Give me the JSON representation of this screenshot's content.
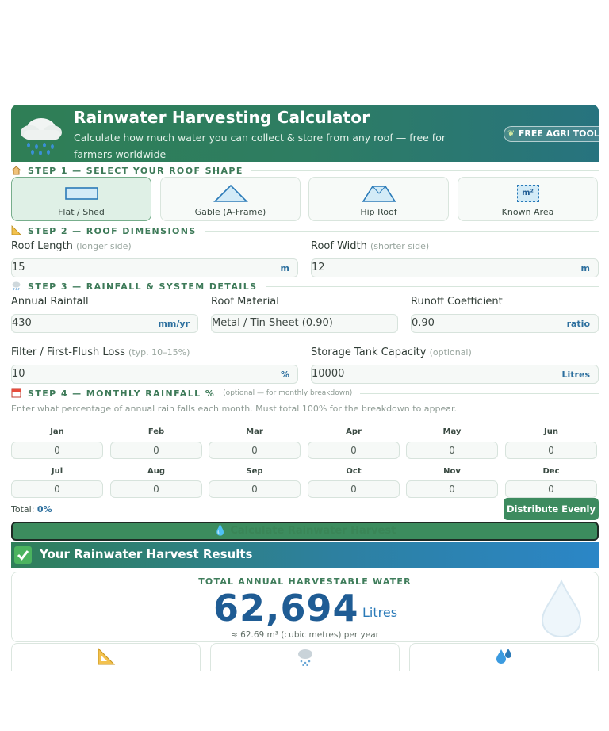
{
  "header": {
    "title": "Rainwater Harvesting Calculator",
    "subtitle": "Calculate how much water you can collect & store from any roof — free for farmers worldwide",
    "badge": "FREE AGRI TOOL"
  },
  "step1": {
    "heading": "STEP 1 — SELECT YOUR ROOF SHAPE",
    "shapes": [
      {
        "label": "Flat / Shed",
        "selected": true
      },
      {
        "label": "Gable (A-Frame)",
        "selected": false
      },
      {
        "label": "Hip Roof",
        "selected": false
      },
      {
        "label": "Known Area",
        "selected": false,
        "icon_text": "m²"
      }
    ]
  },
  "step2": {
    "heading": "STEP 2 — ROOF DIMENSIONS",
    "length": {
      "label": "Roof Length",
      "hint": "(longer side)",
      "value": "15",
      "unit": "m"
    },
    "width": {
      "label": "Roof Width",
      "hint": "(shorter side)",
      "value": "12",
      "unit": "m"
    }
  },
  "step3": {
    "heading": "STEP 3 — RAINFALL & SYSTEM DETAILS",
    "rainfall": {
      "label": "Annual Rainfall",
      "value": "430",
      "unit": "mm/yr"
    },
    "material": {
      "label": "Roof Material",
      "value": "Metal / Tin Sheet (0.90)"
    },
    "runoff": {
      "label": "Runoff Coefficient",
      "value": "0.90",
      "unit": "ratio"
    },
    "filter": {
      "label": "Filter / First-Flush Loss",
      "hint": "(typ. 10–15%)",
      "value": "10",
      "unit": "%"
    },
    "tank": {
      "label": "Storage Tank Capacity",
      "hint": "(optional)",
      "value": "10000",
      "unit": "Litres"
    }
  },
  "step4": {
    "heading": "STEP 4 — MONTHLY RAINFALL %",
    "optional_note": "(optional — for monthly breakdown)",
    "hint": "Enter what percentage of annual rain falls each month. Must total 100% for the breakdown to appear.",
    "months": [
      {
        "name": "Jan",
        "value": "0"
      },
      {
        "name": "Feb",
        "value": "0"
      },
      {
        "name": "Mar",
        "value": "0"
      },
      {
        "name": "Apr",
        "value": "0"
      },
      {
        "name": "May",
        "value": "0"
      },
      {
        "name": "Jun",
        "value": "0"
      },
      {
        "name": "Jul",
        "value": "0"
      },
      {
        "name": "Aug",
        "value": "0"
      },
      {
        "name": "Sep",
        "value": "0"
      },
      {
        "name": "Oct",
        "value": "0"
      },
      {
        "name": "Nov",
        "value": "0"
      },
      {
        "name": "Dec",
        "value": "0"
      }
    ],
    "total_label": "Total:",
    "total_value": "0%",
    "distribute_label": "Distribute Evenly"
  },
  "calculate_label": "Calculate Rainwater Harvest",
  "results": {
    "heading": "Your Rainwater Harvest Results",
    "caption": "TOTAL ANNUAL HARVESTABLE WATER",
    "value": "62,694",
    "unit": "Litres",
    "sub": "≈ 62.69 m³ (cubic metres) per year"
  },
  "colors": {
    "primary_green": "#2f7e55",
    "accent_blue": "#2c6f9e",
    "result_blue": "#1f5c94"
  }
}
